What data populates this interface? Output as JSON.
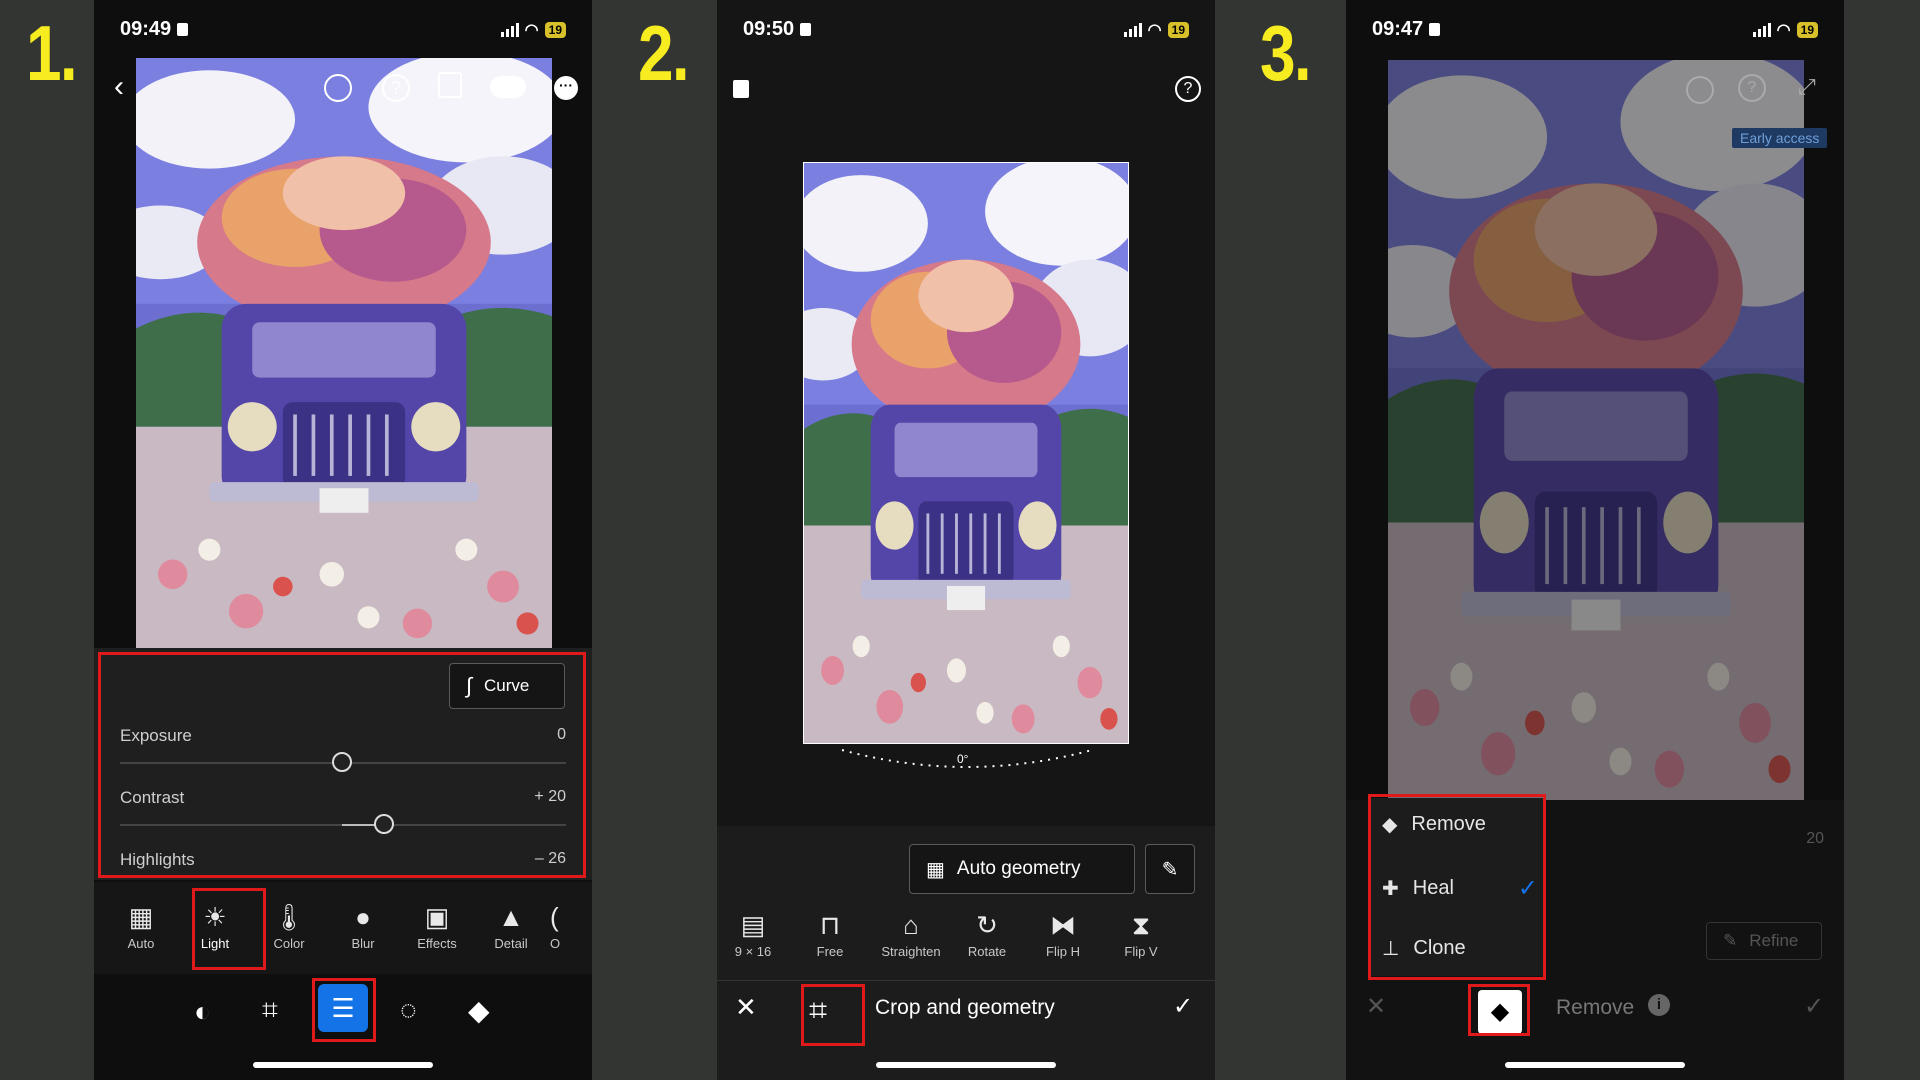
{
  "steps": [
    "1.",
    "2.",
    "3."
  ],
  "colors": {
    "accent_red": "#e0191b",
    "step_yellow": "#f6ec1f",
    "active_blue": "#1473e6"
  },
  "phone1": {
    "time": "09:49",
    "battery": "19",
    "curve_label": "Curve",
    "sliders": [
      {
        "label": "Exposure",
        "value": "0"
      },
      {
        "label": "Contrast",
        "value": "+ 20"
      },
      {
        "label": "Highlights",
        "value": "– 26"
      }
    ],
    "tools": [
      {
        "label": "Auto",
        "icon": "auto-icon"
      },
      {
        "label": "Light",
        "icon": "sun-icon"
      },
      {
        "label": "Color",
        "icon": "thermometer-icon"
      },
      {
        "label": "Blur",
        "icon": "drop-icon"
      },
      {
        "label": "Effects",
        "icon": "vignette-icon"
      },
      {
        "label": "Detail",
        "icon": "triangle-icon"
      },
      {
        "label": "O",
        "icon": "optics-icon"
      }
    ]
  },
  "phone2": {
    "time": "09:50",
    "battery": "19",
    "angle": "0°",
    "auto_geometry": "Auto geometry",
    "tools": [
      {
        "label": "9 × 16"
      },
      {
        "label": "Free"
      },
      {
        "label": "Straighten"
      },
      {
        "label": "Rotate"
      },
      {
        "label": "Flip H"
      },
      {
        "label": "Flip V"
      }
    ],
    "bottom_title": "Crop and geometry"
  },
  "phone3": {
    "time": "09:47",
    "battery": "19",
    "badge": "Early access",
    "menu": [
      {
        "label": "Remove"
      },
      {
        "label": "Heal",
        "checked": true
      },
      {
        "label": "Clone"
      }
    ],
    "bg_value": "20",
    "refine": "Refine",
    "bottom_title": "Remove"
  }
}
